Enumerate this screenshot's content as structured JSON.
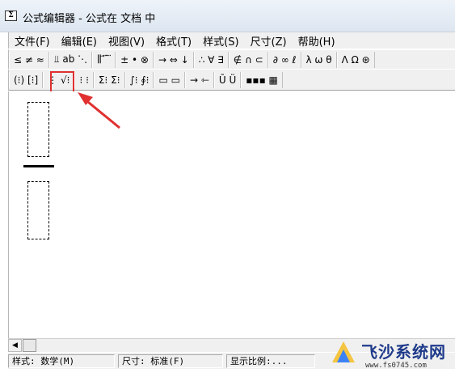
{
  "window": {
    "title": "公式编辑器 - 公式在 文档 中",
    "icon_text": "Σ"
  },
  "menu": [
    {
      "label": "文件(F)"
    },
    {
      "label": "编辑(E)"
    },
    {
      "label": "视图(V)"
    },
    {
      "label": "格式(T)"
    },
    {
      "label": "样式(S)"
    },
    {
      "label": "尺寸(Z)"
    },
    {
      "label": "帮助(H)"
    }
  ],
  "toolbar_row1": [
    {
      "name": "relational-symbols",
      "glyphs": "≤ ≠ ≈"
    },
    {
      "name": "spaces-ellipses",
      "glyphs": "⫫ ab ⋱"
    },
    {
      "name": "embellishments",
      "glyphs": "⫼ ⃗ ⃛ ⃛"
    },
    {
      "name": "operator-symbols",
      "glyphs": "± • ⊗"
    },
    {
      "name": "arrow-symbols",
      "glyphs": "→ ⇔ ↓"
    },
    {
      "name": "logical-symbols",
      "glyphs": "∴ ∀ ∃"
    },
    {
      "name": "set-theory-symbols",
      "glyphs": "∉ ∩ ⊂"
    },
    {
      "name": "misc-symbols",
      "glyphs": "∂ ∞ ℓ"
    },
    {
      "name": "greek-lowercase",
      "glyphs": "λ ω θ"
    },
    {
      "name": "greek-uppercase",
      "glyphs": "Λ Ω ⊛"
    }
  ],
  "toolbar_row2": [
    {
      "name": "fence-templates",
      "glyphs": "(⁝) [⁝]"
    },
    {
      "name": "fraction-radical-templates",
      "glyphs": "⋮ √⁝"
    },
    {
      "name": "subscript-superscript-templates",
      "glyphs": "⁝ ⁝"
    },
    {
      "name": "summation-templates",
      "glyphs": "Σ⁝ Σ⁝"
    },
    {
      "name": "integral-templates",
      "glyphs": "∫⁝ ∮⁝"
    },
    {
      "name": "underbar-overbar-templates",
      "glyphs": "▭ ▭"
    },
    {
      "name": "labeled-arrow-templates",
      "glyphs": "→ ⇽"
    },
    {
      "name": "product-templates",
      "glyphs": "Ū Ü"
    },
    {
      "name": "matrix-templates",
      "glyphs": "▪▪▪ ▦"
    }
  ],
  "status": {
    "style": "样式: 数学(M)",
    "size": "尺寸: 标准(F)",
    "zoom": "显示比例:..."
  },
  "watermark": {
    "title": "飞沙系统网",
    "url": "www.fs0745.com"
  },
  "colors": {
    "highlight": "#e03030",
    "arrow": "#e03030"
  }
}
